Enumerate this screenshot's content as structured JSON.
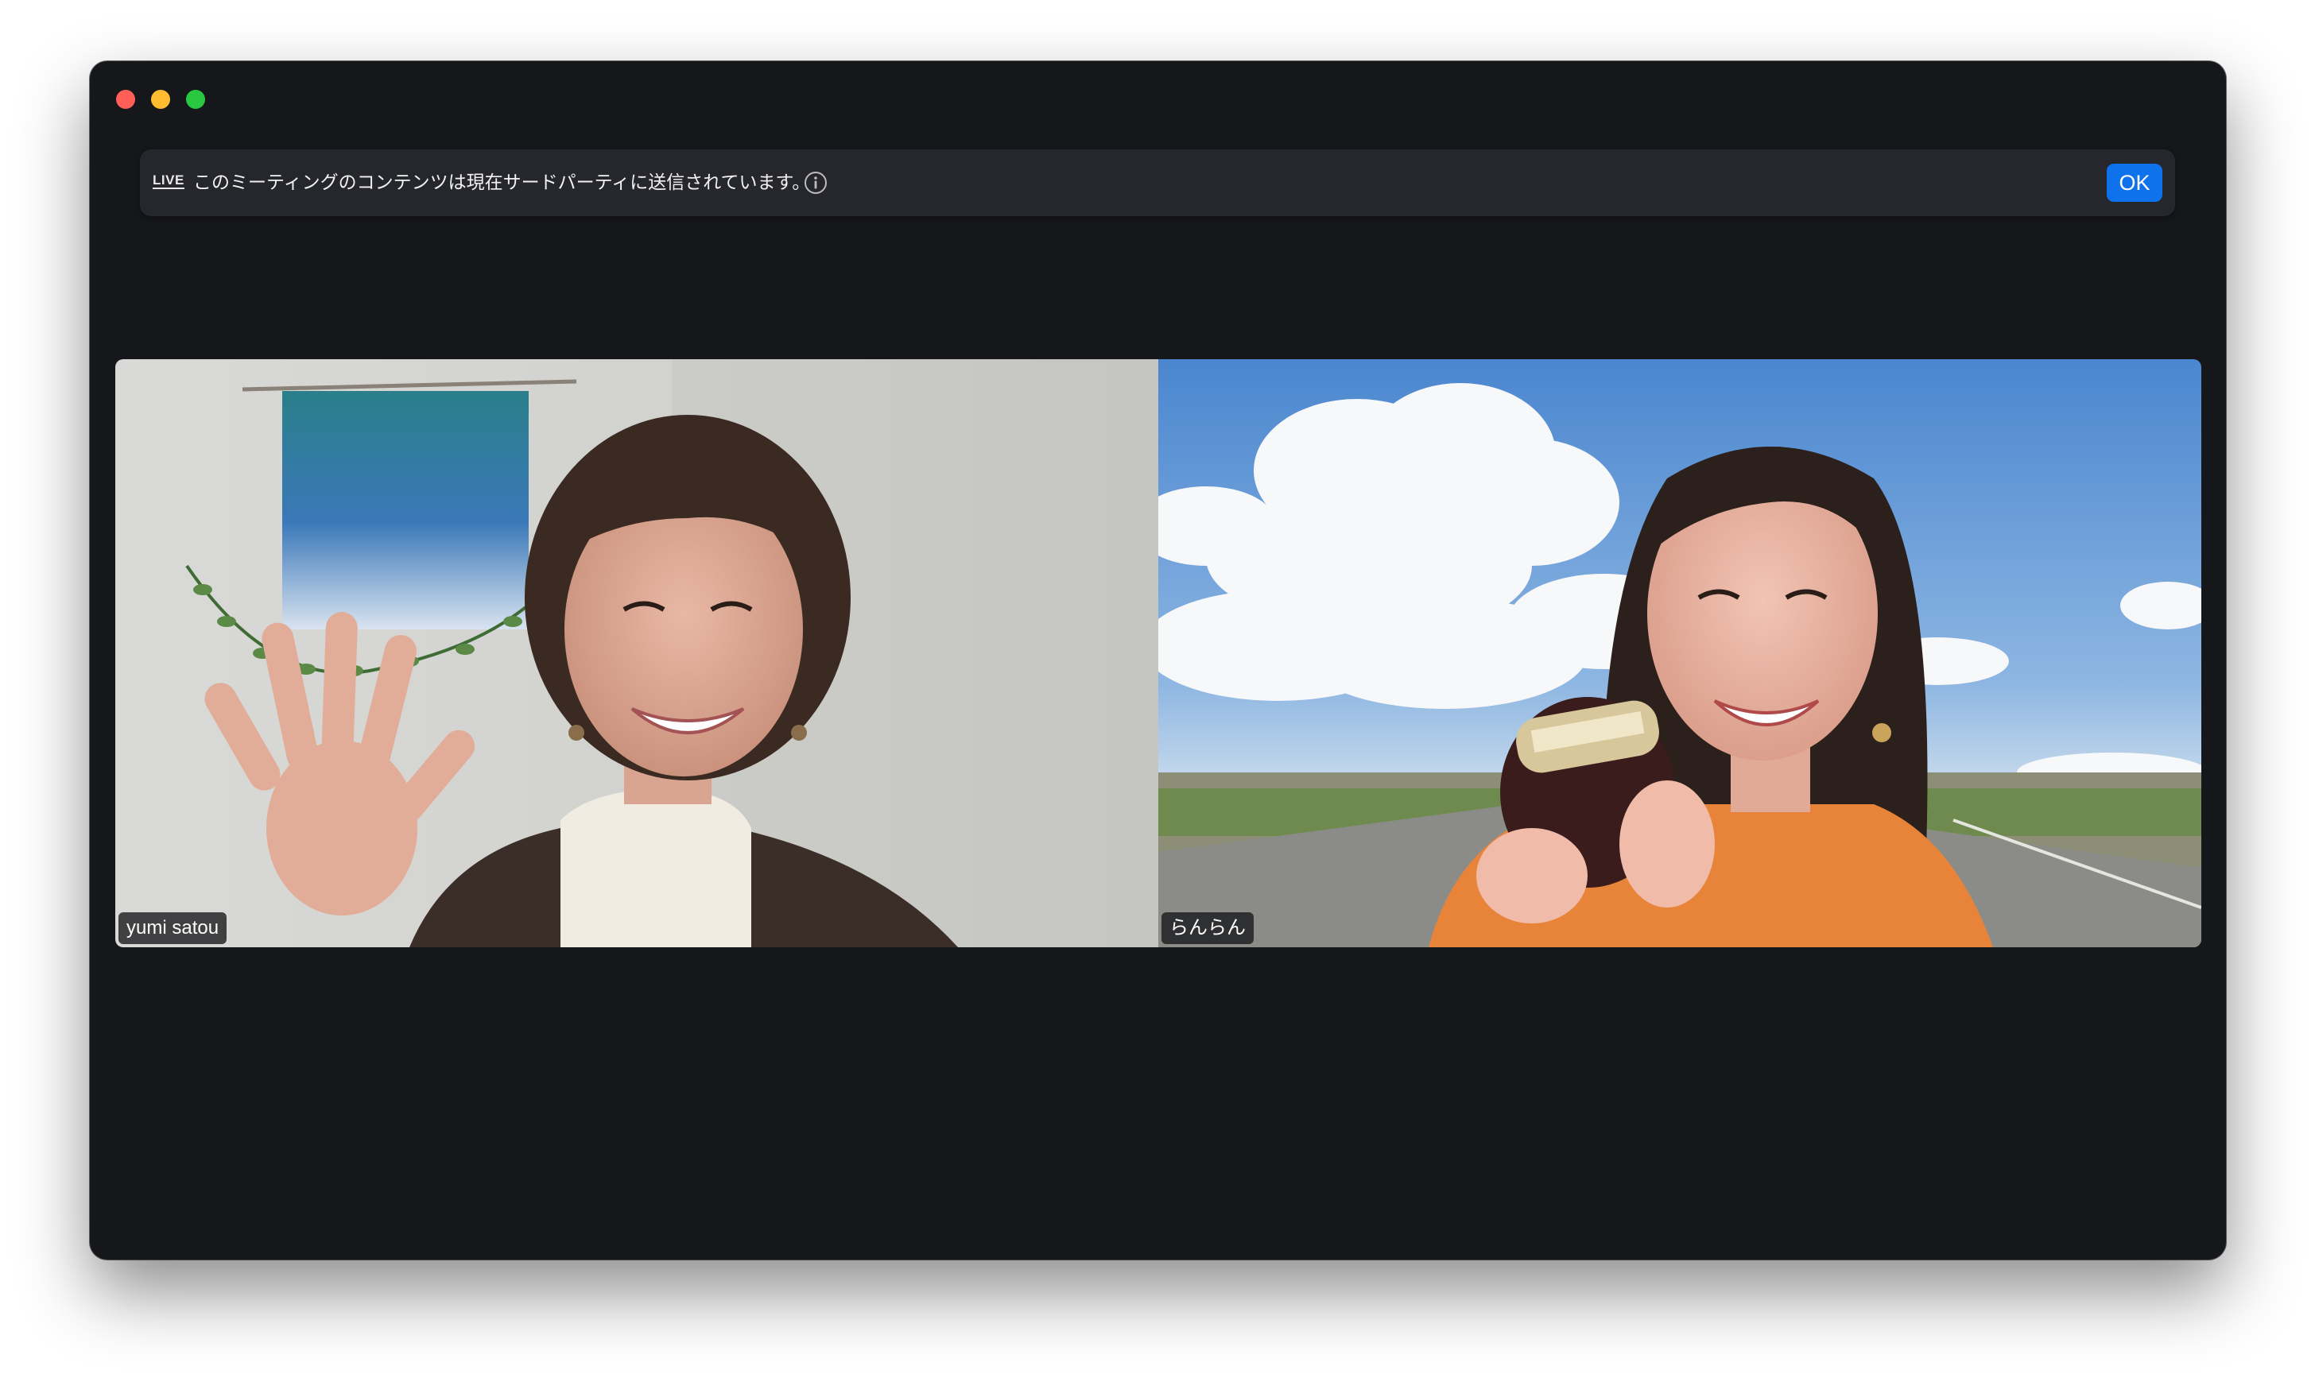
{
  "window": {
    "controls": [
      "close",
      "minimize",
      "maximize"
    ]
  },
  "banner": {
    "live_label": "LIVE",
    "message": "このミーティングのコンテンツは現在サードパーティに送信されています。",
    "ok_label": "OK",
    "info_icon": "info-circle-icon"
  },
  "participants": [
    {
      "name": "yumi satou"
    },
    {
      "name": "らんらん"
    }
  ],
  "colors": {
    "window_bg": "#16171b",
    "banner_bg": "#26272c",
    "accent": "#0e72ed"
  }
}
